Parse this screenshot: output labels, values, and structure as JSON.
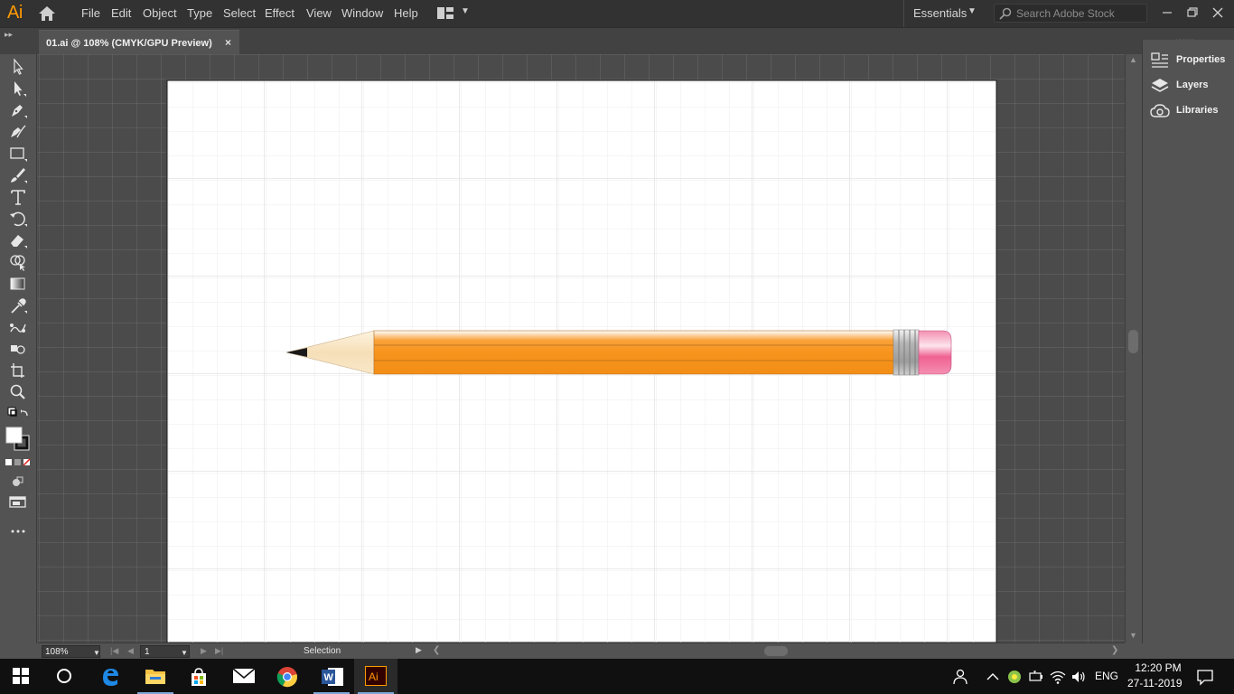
{
  "app": {
    "logo": "Ai",
    "menu": [
      "File",
      "Edit",
      "Object",
      "Type",
      "Select",
      "Effect",
      "View",
      "Window",
      "Help"
    ],
    "workspace": "Essentials",
    "search_placeholder": "Search Adobe Stock"
  },
  "tab": {
    "title": "01.ai @ 108% (CMYK/GPU Preview)",
    "close": "×"
  },
  "tools": [
    "selection-tool",
    "direct-selection-tool",
    "pen-tool",
    "curvature-tool",
    "rectangle-tool",
    "paintbrush-tool",
    "type-tool",
    "rotate-tool",
    "eraser-tool",
    "shape-builder-tool",
    "gradient-tool",
    "eyedropper-tool",
    "blend-tool",
    "symbol-sprayer-tool",
    "artboard-tool",
    "zoom-tool"
  ],
  "panels": [
    {
      "label": "Properties",
      "icon": "properties-icon"
    },
    {
      "label": "Layers",
      "icon": "layers-icon"
    },
    {
      "label": "Libraries",
      "icon": "libraries-icon"
    }
  ],
  "status": {
    "zoom": "108%",
    "artboard": "1",
    "tool": "Selection"
  },
  "taskbar": {
    "apps": [
      "start",
      "cortana",
      "edge",
      "file-explorer",
      "store",
      "mail",
      "chrome",
      "word",
      "illustrator"
    ],
    "language": "ENG",
    "time": "12:20 PM",
    "date": "27-11-2019"
  },
  "colors": {
    "accent": "#ff9a00",
    "pencil_body": "#f7941d",
    "eraser": "#f48fb1"
  }
}
